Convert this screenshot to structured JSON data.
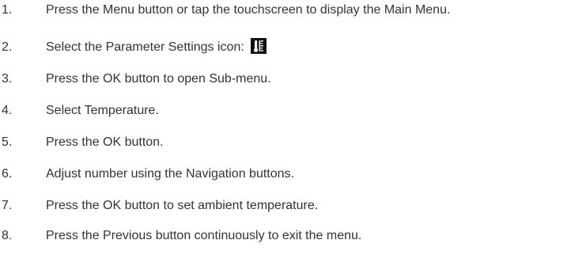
{
  "steps": [
    {
      "num": "1.",
      "text": "Press the Menu button or tap the touchscreen to display the Main Menu."
    },
    {
      "num": "2.",
      "text": "Select the Parameter Settings icon:",
      "icon": "parameter-settings-icon"
    },
    {
      "num": "3.",
      "text": "Press the OK button to open Sub-menu."
    },
    {
      "num": "4.",
      "text": "Select Temperature."
    },
    {
      "num": "5.",
      "text": "Press the OK button."
    },
    {
      "num": "6.",
      "text": "Adjust number using the Navigation buttons."
    },
    {
      "num": "7.",
      "text": "Press the OK button to set ambient temperature."
    },
    {
      "num": "8.",
      "text": "Press the Previous button continuously to exit the menu."
    }
  ]
}
